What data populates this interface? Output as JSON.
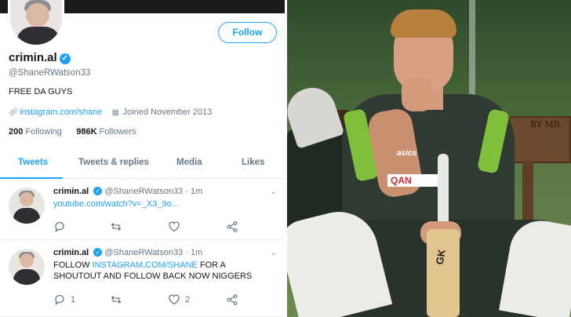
{
  "profile": {
    "follow_label": "Follow",
    "name": "crimin.al",
    "handle": "@ShaneRWatson33",
    "bio": "FREE DA GUYS",
    "link": "instagram.com/shane",
    "joined": "Joined November 2013",
    "following_count": "200",
    "following_label": "Following",
    "followers_count": "986K",
    "followers_label": "Followers"
  },
  "tabs": [
    {
      "label": "Tweets",
      "active": true
    },
    {
      "label": "Tweets & replies",
      "active": false
    },
    {
      "label": "Media",
      "active": false
    },
    {
      "label": "Likes",
      "active": false
    }
  ],
  "tweets": [
    {
      "name": "crimin.al",
      "handle": "@ShaneRWatson33",
      "sep": "·",
      "time": "1m",
      "link": "youtube.com/watch?v=_X3_9o...",
      "reply_count": "",
      "like_count": ""
    },
    {
      "name": "crimin.al",
      "handle": "@ShaneRWatson33",
      "sep": "·",
      "time": "1m",
      "text_pre": "FOLLOW ",
      "link": "INSTAGRAM.COM/SHANE",
      "text_post": " FOR A SHOUTOUT AND FOLLOW BACK NOW NIGGERS",
      "reply_count": "1",
      "like_count": "2"
    }
  ],
  "photo": {
    "bench_text": "BY MR",
    "shirt_brand": "asics",
    "shirt_sponsor": "QAN",
    "bat_brand": "GK"
  },
  "colors": {
    "accent": "#1da1f2",
    "muted": "#657786",
    "text": "#14171a"
  }
}
